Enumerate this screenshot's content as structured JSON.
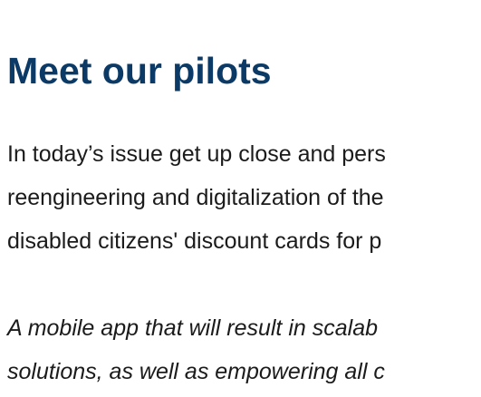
{
  "content": {
    "title": "Meet our pilots",
    "intro_lines": [
      "In today’s issue get up close and pers",
      "reengineering and digitalization of the",
      "disabled citizens' discount cards for p"
    ],
    "quote_lines": [
      "A mobile app that will result in scalab",
      "solutions, as well as empowering all c"
    ]
  }
}
